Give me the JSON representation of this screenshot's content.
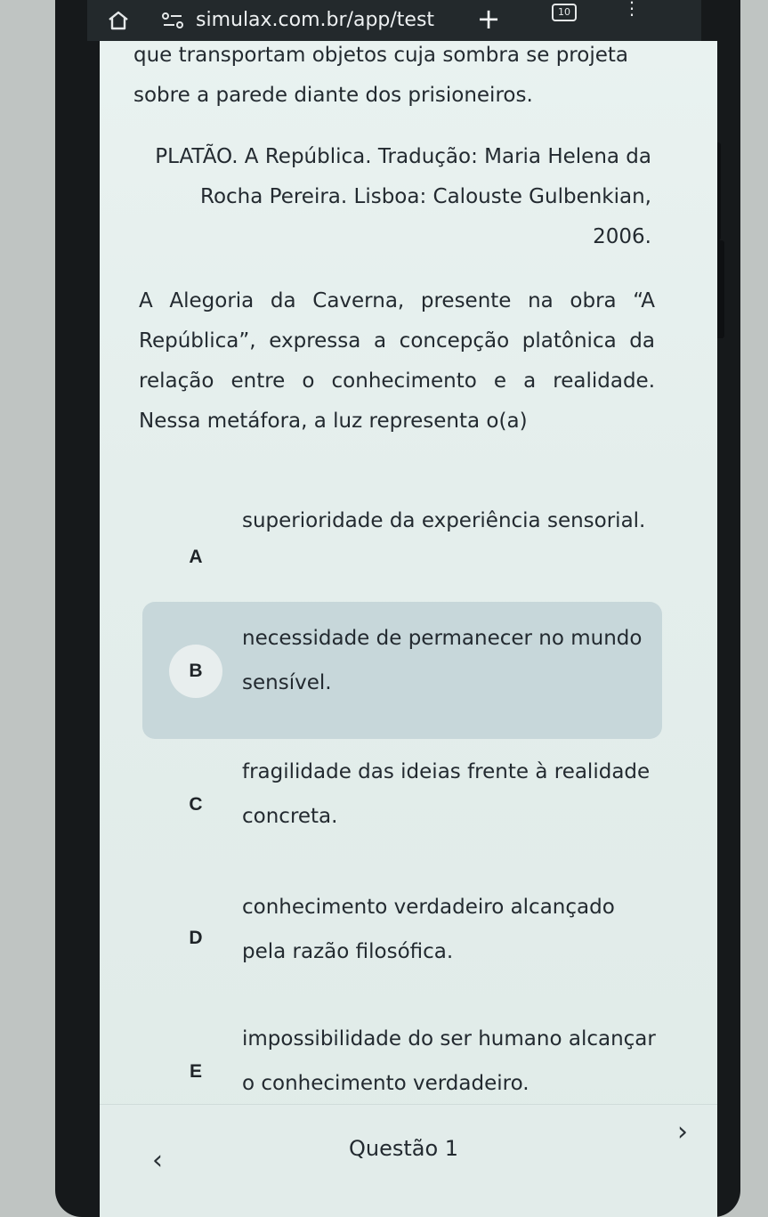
{
  "browser": {
    "url": "simulax.com.br/app/test",
    "tab_count": "10"
  },
  "passage": {
    "continuation": "que transportam objetos cuja sombra se projeta sobre a parede diante dos prisioneiros.",
    "citation": "PLATÃO. A República. Tradução: Maria Helena da Rocha Pereira. Lisboa: Calouste Gulbenkian, 2006."
  },
  "question": {
    "prompt": "A Alegoria da Caverna, presente na obra “A República”, expressa a concepção platônica da relação entre o conhecimento e a realidade. Nessa metáfora, a luz representa o(a)"
  },
  "options": [
    {
      "letter": "A",
      "text": "superioridade da experiência sensorial."
    },
    {
      "letter": "B",
      "text": "necessidade de permanecer no mundo sensível.",
      "selected": true
    },
    {
      "letter": "C",
      "text": "fragilidade das ideias frente à realidade concreta."
    },
    {
      "letter": "D",
      "text": "conhecimento verdadeiro alcançado pela razão filosófica."
    },
    {
      "letter": "E",
      "text": "impossibilidade do ser humano alcançar o conhecimento verdadeiro."
    }
  ],
  "footer": {
    "question_label": "Questão 1",
    "prev_icon": "chevron-left-icon",
    "next_icon": "chevron-right-icon"
  }
}
